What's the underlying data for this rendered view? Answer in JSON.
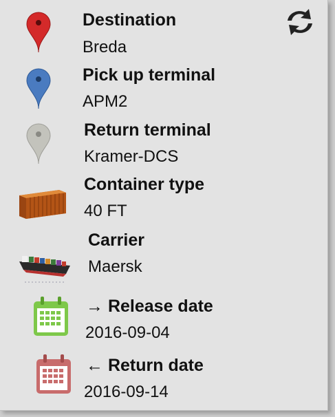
{
  "rows": [
    {
      "title": "Destination",
      "value": "Breda",
      "icon": "red-map-pin-icon",
      "color": "#d42a2a"
    },
    {
      "title": "Pick up terminal",
      "value": "APM2",
      "icon": "blue-map-pin-icon",
      "color": "#4a7bc0"
    },
    {
      "title": "Return terminal",
      "value": "Kramer-DCS",
      "icon": "grey-map-pin-icon",
      "color": "#b9b9b3"
    },
    {
      "title": "Container type",
      "value": "40 FT",
      "icon": "shipping-container-icon",
      "color": "#c5621c"
    },
    {
      "title": "Carrier",
      "value": "Maersk",
      "icon": "container-ship-icon",
      "color": "#b8312f"
    },
    {
      "title": "Release date",
      "value": "2016-09-04",
      "icon": "green-calendar-icon",
      "arrow": "→",
      "color": "#7ec84a"
    },
    {
      "title": "Return date",
      "value": "2016-09-14",
      "icon": "red-calendar-icon",
      "arrow": "←",
      "color": "#c86c6c"
    }
  ],
  "toolbar": {
    "icon": "swap-refresh-icon"
  }
}
